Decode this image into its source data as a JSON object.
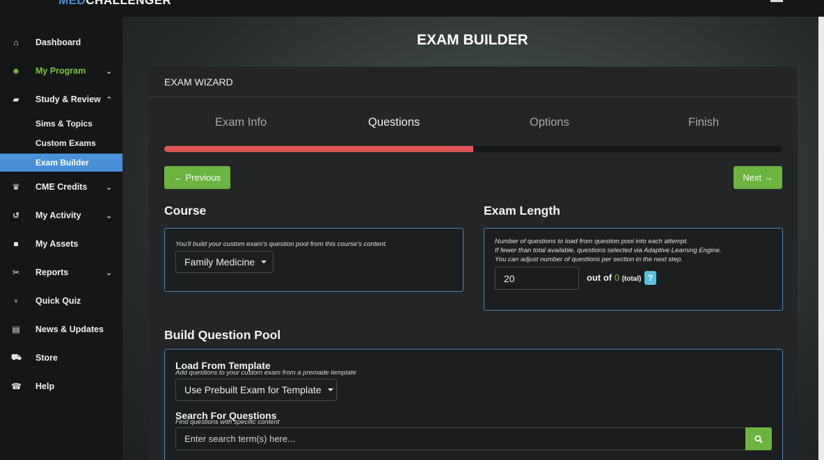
{
  "brand": {
    "prefix": "MED",
    "name": "CHALLENGER"
  },
  "sidebar": {
    "items": [
      {
        "label": "Dashboard",
        "icon": "home-icon",
        "glyph": "⌂"
      },
      {
        "label": "My Program",
        "icon": "users-icon",
        "glyph": "☻"
      },
      {
        "label": "Study & Review",
        "icon": "graduation-cap-icon",
        "glyph": "▰"
      },
      {
        "label": "CME Credits",
        "icon": "certificate-icon",
        "glyph": "♛"
      },
      {
        "label": "My Activity",
        "icon": "history-icon",
        "glyph": "↺"
      },
      {
        "label": "My Assets",
        "icon": "bookmark-icon",
        "glyph": "■"
      },
      {
        "label": "Reports",
        "icon": "wrench-icon",
        "glyph": "✂"
      },
      {
        "label": "Quick Quiz",
        "icon": "trophy-icon",
        "glyph": "♆"
      },
      {
        "label": "News & Updates",
        "icon": "newspaper-icon",
        "glyph": "▤"
      },
      {
        "label": "Store",
        "icon": "cart-icon",
        "glyph": "⛟"
      },
      {
        "label": "Help",
        "icon": "help-icon",
        "glyph": "☎"
      }
    ],
    "sub_items": [
      "Sims & Topics",
      "Custom Exams",
      "Exam Builder"
    ],
    "chevron_down": "⌄",
    "chevron_up": "⌃"
  },
  "page": {
    "title": "EXAM BUILDER"
  },
  "wizard": {
    "title": "EXAM WIZARD",
    "steps": [
      "Exam Info",
      "Questions",
      "Options",
      "Finish"
    ],
    "progress_fraction": 0.5,
    "previous_label": "← Previous",
    "next_label": "Next →"
  },
  "course": {
    "title": "Course",
    "hint": "You'll build your custom exam's question pool from this course's content.",
    "selected": "Family Medicine"
  },
  "exam_length": {
    "title": "Exam Length",
    "hint_lines": [
      "Number of questions to load from question pool into each attempt.",
      "If fewer than total available, questions selected via Adaptive Learning Engine.",
      "You can adjust number of questions per section in the next step."
    ],
    "value": "20",
    "out_of": "out of",
    "available": "0",
    "total_label": "(total)",
    "help": "?"
  },
  "pool": {
    "title": "Build Question Pool",
    "template_title": "Load From Template",
    "template_hint": "Add questions to your custom exam from a premade template",
    "template_selected": "Use Prebuilt Exam for Template",
    "search_title": "Search For Questions",
    "search_hint": "Find questions with specific content",
    "search_placeholder": "Enter search term(s) here..."
  },
  "colors": {
    "accent_green": "#6cb33f",
    "active_blue": "#4a90d9",
    "progress_red": "#e05558",
    "box_border": "#4e86b8"
  }
}
